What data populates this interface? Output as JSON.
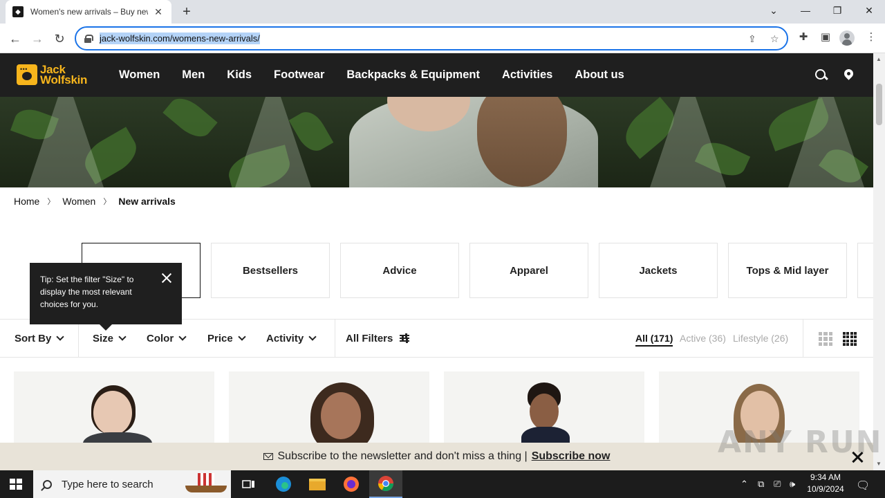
{
  "browser": {
    "tab_title": "Women's new arrivals – Buy new",
    "url": "jack-wolfskin.com/womens-new-arrivals/"
  },
  "site": {
    "logo_line1": "Jack",
    "logo_line2": "Wolfskin",
    "brand_color": "#f7b51c",
    "nav": [
      "Women",
      "Men",
      "Kids",
      "Footwear",
      "Backpacks & Equipment",
      "Activities",
      "About us"
    ]
  },
  "breadcrumb": [
    "Home",
    "Women",
    "New arrivals"
  ],
  "categories": [
    "",
    "Bestsellers",
    "Advice",
    "Apparel",
    "Jackets",
    "Tops & Mid layer"
  ],
  "filters": {
    "sort": "Sort By",
    "size": "Size",
    "color": "Color",
    "price": "Price",
    "activity": "Activity",
    "all_filters": "All Filters"
  },
  "segments": [
    {
      "label": "All (171)",
      "active": true
    },
    {
      "label": "Active (36)",
      "active": false
    },
    {
      "label": "Lifestyle (26)",
      "active": false
    }
  ],
  "tooltip": {
    "text": "Tip: Set the filter \"Size\" to display the most relevant choices for you."
  },
  "newsletter": {
    "text": "Subscribe to the newsletter and don't miss a thing |",
    "link": "Subscribe now"
  },
  "watermark": "ANY RUN",
  "taskbar": {
    "search_placeholder": "Type here to search",
    "time": "9:34 AM",
    "date": "10/9/2024"
  }
}
